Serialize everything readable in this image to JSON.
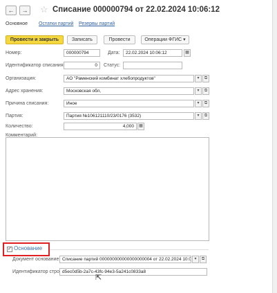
{
  "header": {
    "back_icon": "arrow-left-icon",
    "forward_icon": "arrow-right-icon",
    "back_glyph": "←",
    "forward_glyph": "→",
    "favorite_glyph": "☆",
    "title": "Списание 000000794 от 22.02.2024 10:06:12"
  },
  "tabs": [
    {
      "label": "Основное",
      "active": true
    },
    {
      "label": "Остатки партий",
      "active": false
    },
    {
      "label": "Резервы партий",
      "active": false
    }
  ],
  "toolbar": {
    "post_close": "Провести и закрыть",
    "save": "Записать",
    "post": "Провести",
    "fgis_ops": "Операции ФГИС",
    "dropdown_glyph": "▾"
  },
  "form": {
    "number_label": "Номер:",
    "number_value": "000000794",
    "date_label": "Дата:",
    "date_value": "22.02.2024 10:06:12",
    "writeoff_id_label": "Идентификатор списания:",
    "writeoff_id_value": "0",
    "status_label": "Статус:",
    "status_value": "",
    "org_label": "Организация:",
    "org_value": "АО \"Раменский комбинат хлебопродуктов\"",
    "address_label": "Адрес хранения:",
    "address_value": "Московская обл,",
    "reason_label": "Причина списания:",
    "reason_value": "Иное",
    "batch_label": "Партия:",
    "batch_value": "Партия №106121110/23/0176 (3532)",
    "qty_label": "Количество:",
    "qty_value": "4,000",
    "comment_label": "Комментарий:",
    "comment_value": ""
  },
  "basis": {
    "checked": true,
    "check_glyph": "✓",
    "section_label": "Основание",
    "doc_label": "Документ основание:",
    "doc_value": "Списание партий 000000000000000000004 от 22.02.2024 10:0",
    "row_id_label": "Идентификатор строки:",
    "row_id_value": "d5ec0d5b-2a7c-43fc-94e3-5a241c0833a8"
  },
  "glyphs": {
    "select_arrow": "▾",
    "open_link": "⧉",
    "calendar": "▦",
    "cursor": "⇱"
  },
  "colors": {
    "primary_button": "#f5d840",
    "link": "#2f5fa5",
    "highlight_border": "#e02020",
    "section_label": "#3a6fb0"
  }
}
